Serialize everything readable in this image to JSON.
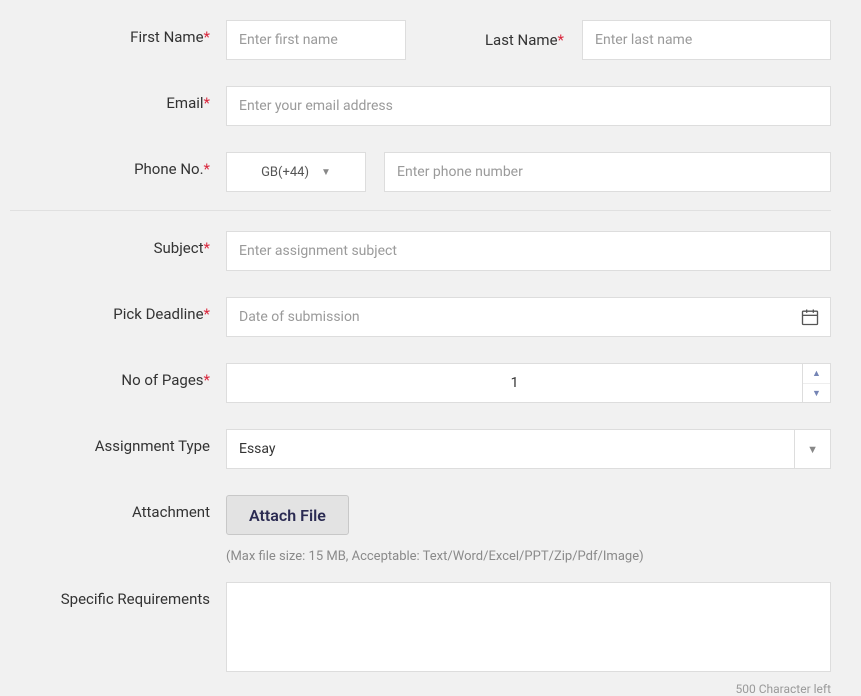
{
  "labels": {
    "first_name": "First Name",
    "last_name": "Last Name",
    "email": "Email",
    "phone": "Phone No.",
    "subject": "Subject",
    "deadline": "Pick Deadline",
    "pages": "No of Pages",
    "assignment_type": "Assignment Type",
    "attachment": "Attachment",
    "requirements": "Specific Requirements",
    "required_mark": "*"
  },
  "placeholders": {
    "first_name": "Enter first name",
    "last_name": "Enter last name",
    "email": "Enter your email address",
    "phone": "Enter phone number",
    "subject": "Enter assignment subject",
    "deadline": "Date of submission"
  },
  "values": {
    "phone_code": "GB(+44)",
    "pages": "1",
    "assignment_type": "Essay"
  },
  "attachment": {
    "button": "Attach File",
    "hint": "(Max file size: 15 MB, Acceptable: Text/Word/Excel/PPT/Zip/Pdf/Image)"
  },
  "char_counter": "500 Character left"
}
